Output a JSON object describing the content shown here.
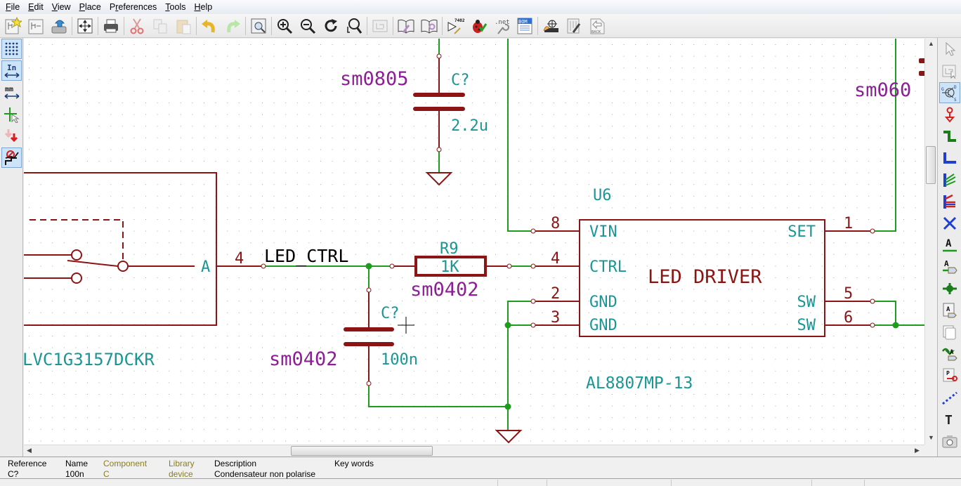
{
  "menu": [
    "File",
    "Edit",
    "View",
    "Place",
    "Preferences",
    "Tools",
    "Help"
  ],
  "menu_accel": [
    "F",
    "E",
    "V",
    "P",
    "r",
    "T",
    "H"
  ],
  "toolbar": {
    "items": [
      "new-schematic",
      "new-sheet",
      "save",
      "page-settings",
      "print",
      "cut",
      "copy",
      "paste",
      "undo",
      "redo",
      "find",
      "zoom-in",
      "zoom-out",
      "redraw",
      "zoom-fit",
      "hierarchy-navigator",
      "library-editor",
      "library-browser",
      "annotate",
      "erc",
      "netlist",
      "bom",
      "run-cvpcb",
      "run-pcbnew",
      "back"
    ],
    "annotate_badge": "7402",
    "netlist_label": ".net",
    "bom_label": "BOM",
    "back_label": "BACK"
  },
  "left_toolbar": [
    "grid-toggle",
    "units-inches",
    "units-mm",
    "cursor-shape",
    "hidden-pins",
    "bus-wire-orientation"
  ],
  "left_toolbar_labels": {
    "inches": "In",
    "mm": "mm"
  },
  "right_toolbar": [
    "select",
    "hierarchy-push",
    "place-component",
    "place-power",
    "place-wire",
    "place-bus",
    "wire-to-bus-entry",
    "bus-to-bus-entry",
    "no-connect",
    "net-label",
    "global-label",
    "junction",
    "hierarchical-label",
    "hierarchical-sheet",
    "import-hierarchical-label",
    "hierarchical-pin",
    "graphic-line",
    "graphic-text",
    "image"
  ],
  "schematic": {
    "colors": {
      "wire": "#1e9c1e",
      "component": "#8b1414",
      "reference": "#1a9696",
      "footprint": "#8c1e96",
      "netlabel": "#000000",
      "grid": "#a8a8a8",
      "junction": "#1e9c1e"
    },
    "c_top": {
      "footprint": "sm0805",
      "reference": "C?",
      "value": "2.2u"
    },
    "u6": {
      "reference": "U6",
      "name": "LED DRIVER",
      "value": "AL8807MP-13",
      "pins_left": [
        {
          "num": "8",
          "name": "VIN"
        },
        {
          "num": "4",
          "name": "CTRL"
        },
        {
          "num": "2",
          "name": "GND"
        },
        {
          "num": "3",
          "name": "GND"
        }
      ],
      "pins_right": [
        {
          "num": "1",
          "name": "SET"
        },
        {
          "num": "5",
          "name": "SW"
        },
        {
          "num": "6",
          "name": "SW"
        }
      ]
    },
    "r9": {
      "reference": "R9",
      "value": "1K",
      "footprint": "sm0402"
    },
    "c_mid": {
      "reference": "C?",
      "value": "100n",
      "footprint": "sm0402"
    },
    "net_label": "LED_CTRL",
    "switch_ic": {
      "pin_name": "A",
      "pin_num": "4",
      "value": "LVC1G3157DCKR"
    },
    "right_partial_footprint": "sm060"
  },
  "info_panel": {
    "reference": {
      "label": "Reference",
      "value": "C?"
    },
    "name": {
      "label": "Name",
      "value": "100n"
    },
    "component": {
      "label": "Component",
      "value": "C"
    },
    "library": {
      "label": "Library",
      "value": "device"
    },
    "description": {
      "label": "Description",
      "value": "Condensateur non polarise"
    },
    "keywords": {
      "label": "Key words",
      "value": ""
    }
  }
}
